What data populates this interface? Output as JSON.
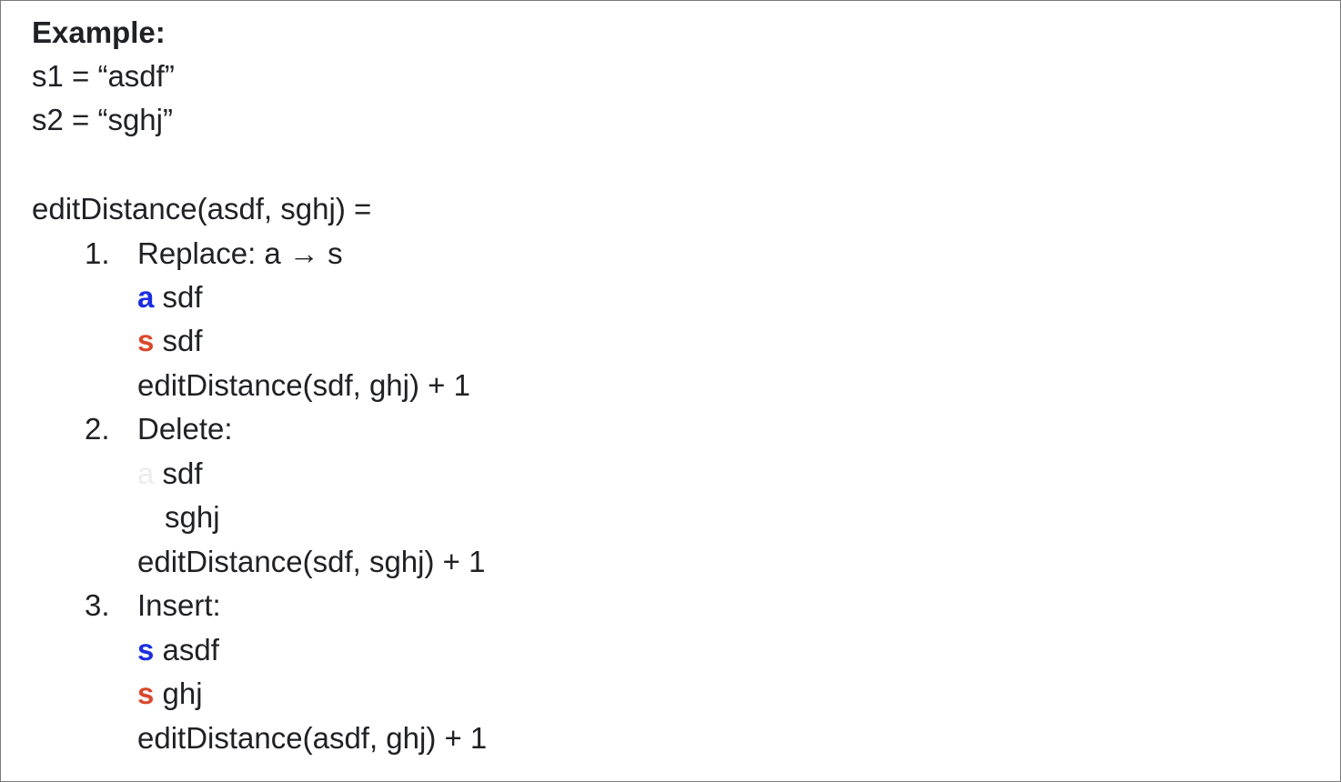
{
  "doc": {
    "heading": "Example:",
    "s1_line": "s1 = “asdf”",
    "s2_line": "s2 = “sghj”",
    "call_line": "editDistance(asdf, sghj) =",
    "steps": [
      {
        "number": "1.",
        "title": "Replace: a → s",
        "rows": [
          {
            "prefix": "a",
            "rest": " sdf"
          },
          {
            "prefix": "s",
            "rest": " sdf"
          }
        ],
        "result": "editDistance(sdf, ghj) + 1"
      },
      {
        "number": "2.",
        "title": "Delete:",
        "rows": [
          {
            "prefix": "a",
            "rest": " sdf"
          },
          {
            "prefix": "",
            "rest": "sghj"
          }
        ],
        "result": "editDistance(sdf, sghj) + 1"
      },
      {
        "number": "3.",
        "title": "Insert:",
        "rows": [
          {
            "prefix": "s",
            "rest": " asdf"
          },
          {
            "prefix": "s",
            "rest": " ghj"
          }
        ],
        "result": "editDistance(asdf, ghj) + 1"
      }
    ]
  },
  "colors": {
    "blue_highlight": "#1a2fe0",
    "red_highlight": "#d9482b",
    "ghost_text": "#ececec",
    "text": "#202124"
  }
}
